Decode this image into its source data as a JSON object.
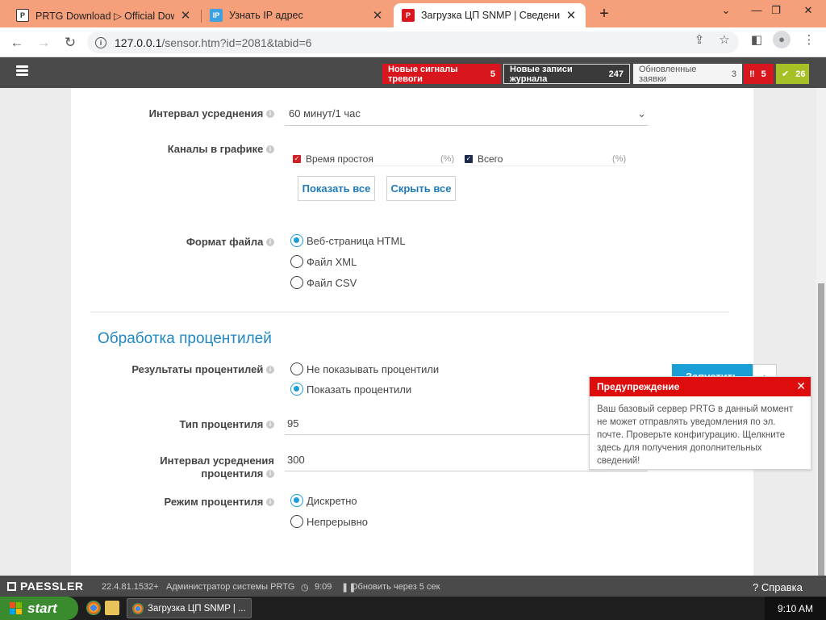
{
  "browser": {
    "tabs": [
      {
        "title": "PRTG Download ▷ Official Down",
        "favicon": "prtg-icon"
      },
      {
        "title": "Узнать IP адрес",
        "favicon": "ip-icon"
      },
      {
        "title": "Загрузка ЦП SNMP | Сведения о",
        "favicon": "prtg-red-icon"
      }
    ],
    "url_host": "127.0.0.1",
    "url_path": "/sensor.htm?id=2081&tabid=6"
  },
  "prtg_nav": {
    "badges": [
      {
        "label": "Новые сигналы тревоги",
        "count": "5",
        "color": "#d9151d"
      },
      {
        "label": "Новые записи журнала",
        "count": "247",
        "color": "#3a3a3a"
      },
      {
        "label": "Обновленные заявки",
        "count": "3",
        "color": "#f4f4f4"
      },
      {
        "label": "‼",
        "count": "5",
        "color": "#d9151d"
      },
      {
        "label": "✔",
        "count": "26",
        "color": "#a6c126"
      }
    ]
  },
  "form": {
    "avg_interval_label": "Интервал усреднения",
    "avg_interval_value": "60 минут/1 час",
    "channels_label": "Каналы в графике",
    "channels": [
      {
        "name": "Время простоя",
        "unit": "(%)",
        "color": "#d11f26"
      },
      {
        "name": "Всего",
        "unit": "(%)",
        "color": "#1b2a4a"
      }
    ],
    "show_all": "Показать все",
    "hide_all": "Скрыть все",
    "file_format_label": "Формат файла",
    "file_formats": [
      "Веб-страница HTML",
      "Файл XML",
      "Файл CSV"
    ],
    "file_format_selected": 0,
    "percentile_section": "Обработка процентилей",
    "percentile_results_label": "Результаты процентилей",
    "percentile_results": [
      "Не показывать процентили",
      "Показать процентили"
    ],
    "percentile_results_selected": 1,
    "percentile_type_label": "Тип процентиля",
    "percentile_type_value": "95",
    "percentile_avg_label_1": "Интервал усреднения",
    "percentile_avg_label_2": "процентиля",
    "percentile_avg_value": "300",
    "percentile_mode_label": "Режим процентиля",
    "percentile_modes": [
      "Дискретно",
      "Непрерывно"
    ],
    "percentile_mode_selected": 0,
    "run_button": "Запустить"
  },
  "warning": {
    "title": "Предупреждение",
    "body": "Ваш базовый сервер PRTG в данный момент не может отправлять уведомления по эл. почте. Проверьте конфигурацию. Щелкните здесь для получения дополнительных сведений!"
  },
  "footer": {
    "brand": "PAESSLER",
    "version": "22.4.81.1532+",
    "user": "Администратор системы PRTG",
    "time": "9:09",
    "refresh": "Обновить через 5 сек",
    "help": "Справка"
  },
  "taskbar": {
    "start": "start",
    "window": "Загрузка ЦП SNMP | ...",
    "clock": "9:10 AM"
  }
}
